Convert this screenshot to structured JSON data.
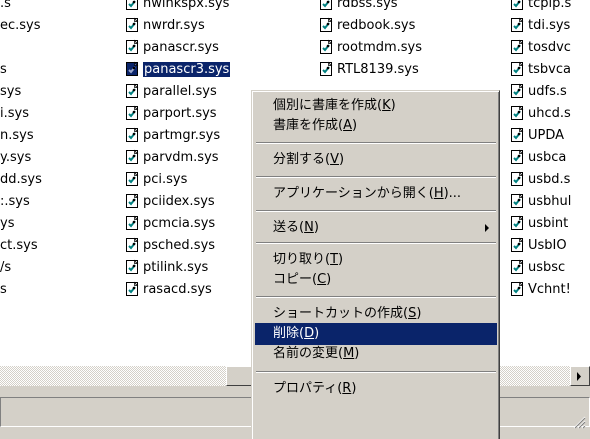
{
  "files": {
    "col0": [
      ".s",
      "ec.sys",
      "",
      "s",
      "sys",
      "i.sys",
      "n.sys",
      "y.sys",
      "dd.sys",
      ":.sys",
      "ys",
      "ct.sys",
      "/s",
      "s"
    ],
    "col1": [
      "nwinkspx.sys",
      "nwrdr.sys",
      "panascr.sys",
      "panascr3.sys",
      "parallel.sys",
      "parport.sys",
      "partmgr.sys",
      "parvdm.sys",
      "pci.sys",
      "pciidex.sys",
      "pcmcia.sys",
      "psched.sys",
      "ptilink.sys",
      "rasacd.sys"
    ],
    "col2": [
      "rdbss.sys",
      "redbook.sys",
      "rootmdm.sys",
      "RTL8139.sys"
    ],
    "col3": [
      "tcpip.s",
      "tdi.sys",
      "tosdvc",
      "tsbvca",
      "udfs.s",
      "uhcd.s",
      "UPDA",
      "usbca",
      "usbd.s",
      "usbhul",
      "usbint",
      "UsbIO",
      "usbsc",
      "Vchnt!"
    ]
  },
  "selected_file": "panascr3.sys",
  "context_menu": {
    "items": [
      {
        "label": "個別に書庫を作成(K)",
        "mnemonic": "K"
      },
      {
        "label": "書庫を作成(A)",
        "mnemonic": "A"
      },
      {
        "label": "分割する(V)",
        "mnemonic": "V"
      },
      {
        "label": "アプリケーションから開く(H)...",
        "mnemonic": "H"
      },
      {
        "label": "送る(N)",
        "mnemonic": "N",
        "submenu": true
      },
      {
        "label": "切り取り(T)",
        "mnemonic": "T"
      },
      {
        "label": "コピー(C)",
        "mnemonic": "C"
      },
      {
        "label": "ショートカットの作成(S)",
        "mnemonic": "S"
      },
      {
        "label": "削除(D)",
        "mnemonic": "D",
        "highlighted": true
      },
      {
        "label": "名前の変更(M)",
        "mnemonic": "M"
      },
      {
        "label": "プロパティ(R)",
        "mnemonic": "R"
      }
    ]
  },
  "colors": {
    "selection": "#0a246a",
    "chrome": "#d4d0c8"
  },
  "icons": {
    "file": "system-file-icon",
    "scroll_right": "arrow-right-icon"
  }
}
